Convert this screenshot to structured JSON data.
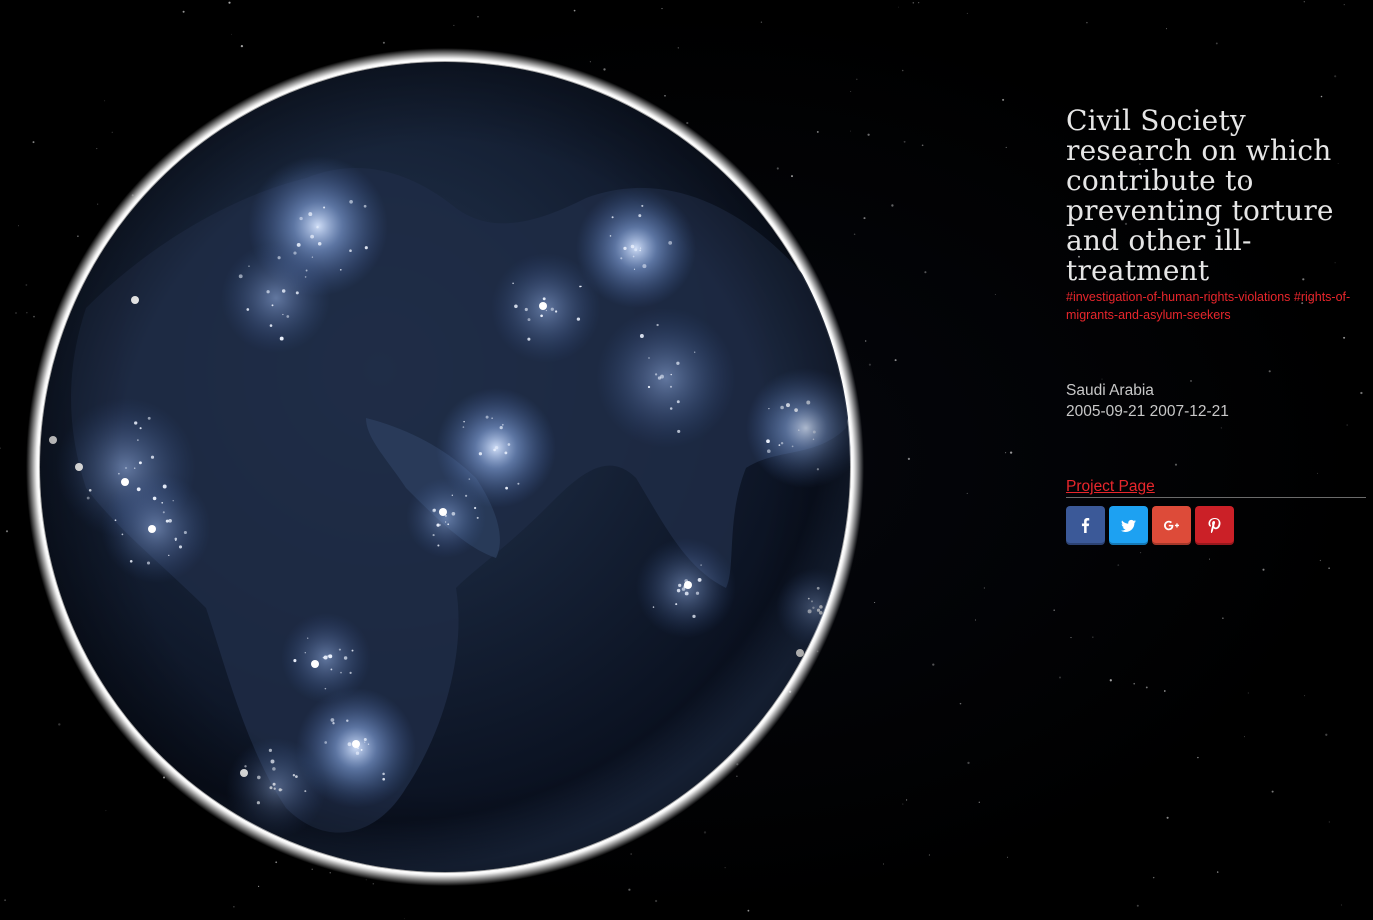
{
  "panel": {
    "title": "Civil Society research on which contribute to preventing torture and other ill-treatment",
    "tags": [
      "#investigation-of-human-rights-violations",
      "#rights-of-migrants-and-asylum-seekers"
    ],
    "country": "Saudi Arabia",
    "dates": "2005-09-21 2007-12-21",
    "project_link": "Project Page"
  },
  "share_buttons": [
    {
      "network": "facebook",
      "icon": "facebook-icon",
      "color": "#3b5998"
    },
    {
      "network": "twitter",
      "icon": "twitter-icon",
      "color": "#1da1f2"
    },
    {
      "network": "google-plus",
      "icon": "google-plus-icon",
      "color": "#dd4b39"
    },
    {
      "network": "pinterest",
      "icon": "pinterest-icon",
      "color": "#cb2027"
    }
  ],
  "colors": {
    "accent": "#e8262c",
    "glow": "#ffffff",
    "city_light": "#9fc2ff"
  }
}
